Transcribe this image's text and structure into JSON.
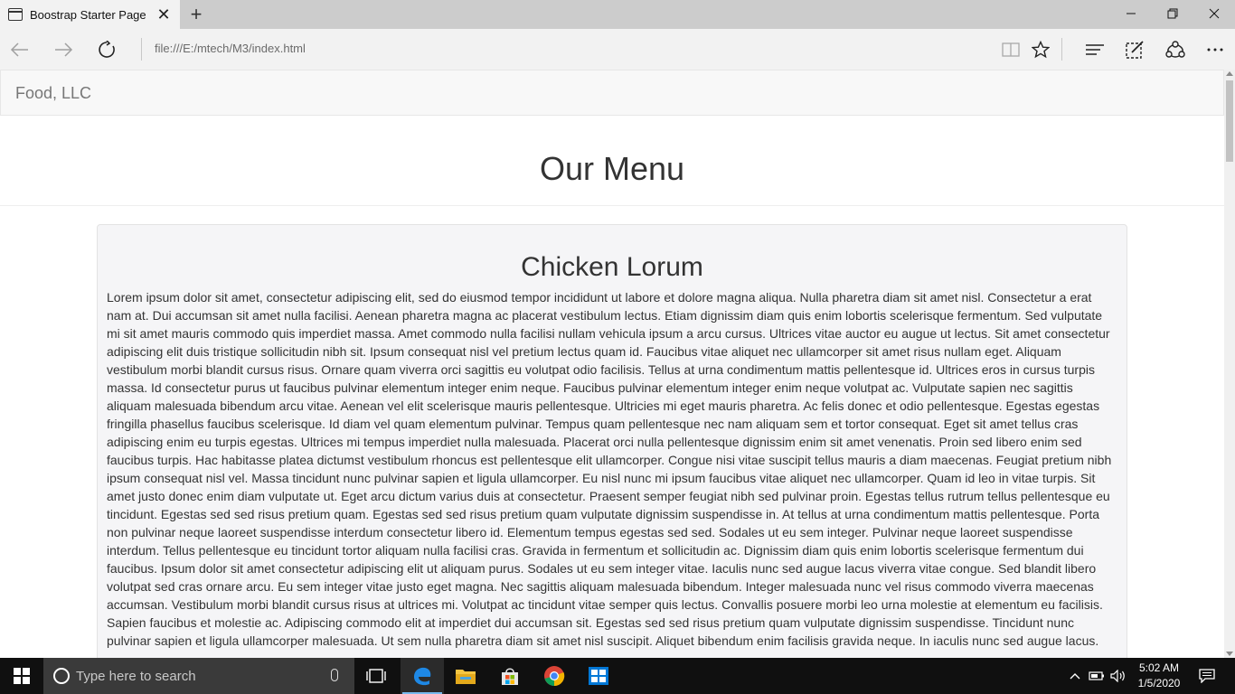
{
  "browser": {
    "tab_title": "Boostrap Starter Page",
    "url": "file:///E:/mtech/M3/index.html"
  },
  "site": {
    "brand": "Food, LLC",
    "page_title": "Our Menu",
    "sections": [
      {
        "title": "Chicken Lorum",
        "body": "Lorem ipsum dolor sit amet, consectetur adipiscing elit, sed do eiusmod tempor incididunt ut labore et dolore magna aliqua. Nulla pharetra diam sit amet nisl. Consectetur a erat nam at. Dui accumsan sit amet nulla facilisi. Aenean pharetra magna ac placerat vestibulum lectus. Etiam dignissim diam quis enim lobortis scelerisque fermentum. Sed vulputate mi sit amet mauris commodo quis imperdiet massa. Amet commodo nulla facilisi nullam vehicula ipsum a arcu cursus. Ultrices vitae auctor eu augue ut lectus. Sit amet consectetur adipiscing elit duis tristique sollicitudin nibh sit. Ipsum consequat nisl vel pretium lectus quam id. Faucibus vitae aliquet nec ullamcorper sit amet risus nullam eget. Aliquam vestibulum morbi blandit cursus risus. Ornare quam viverra orci sagittis eu volutpat odio facilisis. Tellus at urna condimentum mattis pellentesque id. Ultrices eros in cursus turpis massa. Id consectetur purus ut faucibus pulvinar elementum integer enim neque. Faucibus pulvinar elementum integer enim neque volutpat ac. Vulputate sapien nec sagittis aliquam malesuada bibendum arcu vitae. Aenean vel elit scelerisque mauris pellentesque. Ultricies mi eget mauris pharetra. Ac felis donec et odio pellentesque. Egestas egestas fringilla phasellus faucibus scelerisque. Id diam vel quam elementum pulvinar. Tempus quam pellentesque nec nam aliquam sem et tortor consequat. Eget sit amet tellus cras adipiscing enim eu turpis egestas. Ultrices mi tempus imperdiet nulla malesuada. Placerat orci nulla pellentesque dignissim enim sit amet venenatis. Proin sed libero enim sed faucibus turpis. Hac habitasse platea dictumst vestibulum rhoncus est pellentesque elit ullamcorper. Congue nisi vitae suscipit tellus mauris a diam maecenas. Feugiat pretium nibh ipsum consequat nisl vel. Massa tincidunt nunc pulvinar sapien et ligula ullamcorper. Eu nisl nunc mi ipsum faucibus vitae aliquet nec ullamcorper. Quam id leo in vitae turpis. Sit amet justo donec enim diam vulputate ut. Eget arcu dictum varius duis at consectetur. Praesent semper feugiat nibh sed pulvinar proin. Egestas tellus rutrum tellus pellentesque eu tincidunt. Egestas sed sed risus pretium quam. Egestas sed sed risus pretium quam vulputate dignissim suspendisse in. At tellus at urna condimentum mattis pellentesque. Porta non pulvinar neque laoreet suspendisse interdum consectetur libero id. Elementum tempus egestas sed sed. Sodales ut eu sem integer. Pulvinar neque laoreet suspendisse interdum. Tellus pellentesque eu tincidunt tortor aliquam nulla facilisi cras. Gravida in fermentum et sollicitudin ac. Dignissim diam quis enim lobortis scelerisque fermentum dui faucibus. Ipsum dolor sit amet consectetur adipiscing elit ut aliquam purus. Sodales ut eu sem integer vitae. Iaculis nunc sed augue lacus viverra vitae congue. Sed blandit libero volutpat sed cras ornare arcu. Eu sem integer vitae justo eget magna. Nec sagittis aliquam malesuada bibendum. Integer malesuada nunc vel risus commodo viverra maecenas accumsan. Vestibulum morbi blandit cursus risus at ultrices mi. Volutpat ac tincidunt vitae semper quis lectus. Convallis posuere morbi leo urna molestie at elementum eu facilisis. Sapien faucibus et molestie ac. Adipiscing commodo elit at imperdiet dui accumsan sit. Egestas sed sed risus pretium quam vulputate dignissim suspendisse. Tincidunt nunc pulvinar sapien et ligula ullamcorper malesuada. Ut sem nulla pharetra diam sit amet nisl suscipit. Aliquet bibendum enim facilisis gravida neque. In iaculis nunc sed augue lacus."
      }
    ]
  },
  "taskbar": {
    "search_placeholder": "Type here to search",
    "time": "5:02 AM",
    "date": "1/5/2020"
  },
  "icons": {
    "tab": "tab-icon",
    "close": "close-icon",
    "new_tab": "plus-icon",
    "back": "back-arrow-icon",
    "forward": "forward-arrow-icon",
    "refresh": "refresh-icon",
    "reading_view": "book-icon",
    "favorite": "star-icon",
    "hub": "hub-icon",
    "notes": "pen-icon",
    "share": "share-icon",
    "more": "ellipsis-icon"
  },
  "colors": {
    "taskbar_bg": "#101010",
    "well_bg": "#f5f5f7",
    "navbar_bg": "#f8f8f8"
  }
}
